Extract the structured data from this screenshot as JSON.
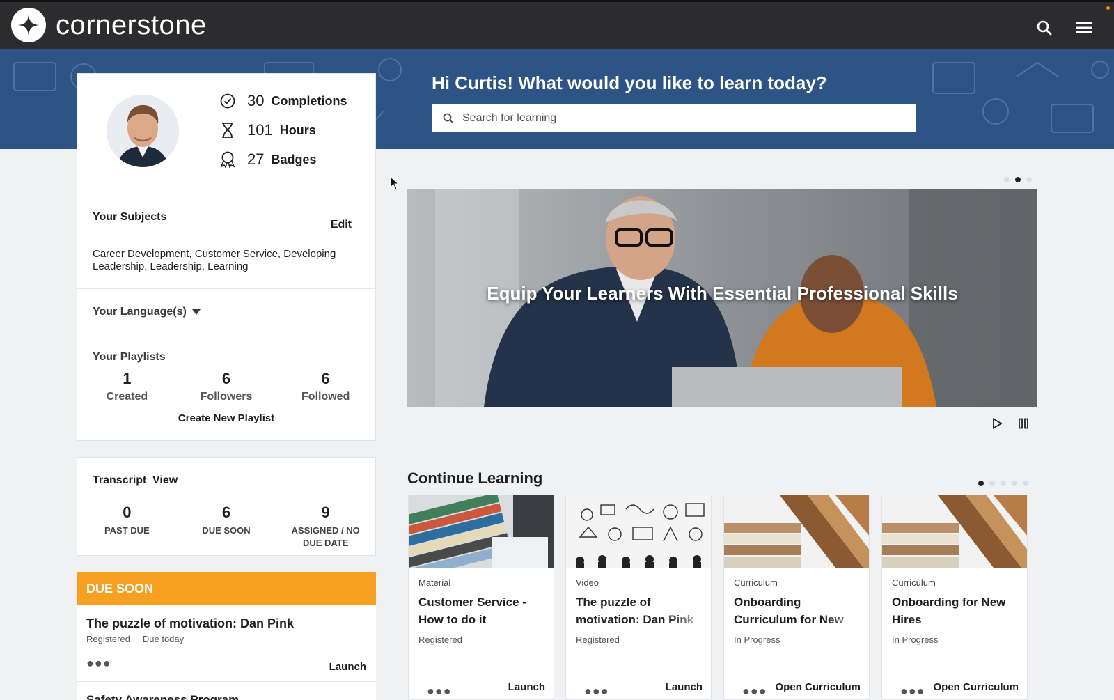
{
  "brand": {
    "name": "cornerstone"
  },
  "header": {
    "greeting": "Hi Curtis! What would you like to learn today?",
    "search_placeholder": "Search for learning"
  },
  "profile": {
    "stats": [
      {
        "value": "30",
        "label": "Completions",
        "icon": "check-circle-icon"
      },
      {
        "value": "101",
        "label": "Hours",
        "icon": "hourglass-icon"
      },
      {
        "value": "27",
        "label": "Badges",
        "icon": "badge-icon"
      }
    ],
    "subjects": {
      "title": "Your Subjects",
      "edit_label": "Edit",
      "list": "Career Development, Customer Service, Developing Leadership, Leadership, Learning"
    },
    "languages_label": "Your Language(s)",
    "playlists": {
      "title": "Your Playlists",
      "counts": [
        {
          "value": "1",
          "label": "Created"
        },
        {
          "value": "6",
          "label": "Followers"
        },
        {
          "value": "6",
          "label": "Followed"
        }
      ],
      "create_label": "Create New Playlist"
    }
  },
  "transcript": {
    "title": "Transcript",
    "view_label": "View",
    "counts": [
      {
        "value": "0",
        "label": "PAST DUE"
      },
      {
        "value": "6",
        "label": "DUE SOON"
      },
      {
        "value": "9",
        "label": "ASSIGNED / NO DUE DATE"
      }
    ]
  },
  "due_soon": {
    "header": "DUE SOON",
    "items": [
      {
        "title": "The puzzle of motivation: Dan Pink",
        "status": "Registered",
        "due": "Due today",
        "action": "Launch"
      },
      {
        "title": "Safety Awareness Program"
      }
    ]
  },
  "banner": {
    "title": "Equip Your Learners With Essential Professional Skills",
    "slides": 3,
    "active_slide": 2
  },
  "continue_learning": {
    "title": "Continue Learning",
    "pages": 5,
    "active_page": 1,
    "cards": [
      {
        "type": "Material",
        "title": "Customer Service - How to do it",
        "status": "Registered",
        "action": "Launch"
      },
      {
        "type": "Video",
        "title": "The puzzle of motivation: Dan Pink",
        "status": "Registered",
        "action": "Launch"
      },
      {
        "type": "Curriculum",
        "title": "Onboarding Curriculum for New Hires",
        "status": "In Progress",
        "action": "Open Curriculum"
      },
      {
        "type": "Curriculum",
        "title": "Onboarding for New Hires",
        "status": "In Progress",
        "action": "Open Curriculum"
      }
    ]
  },
  "colors": {
    "topbar": "#2c2c2e",
    "hero": "#2e5485",
    "accent": "#f5a021"
  }
}
